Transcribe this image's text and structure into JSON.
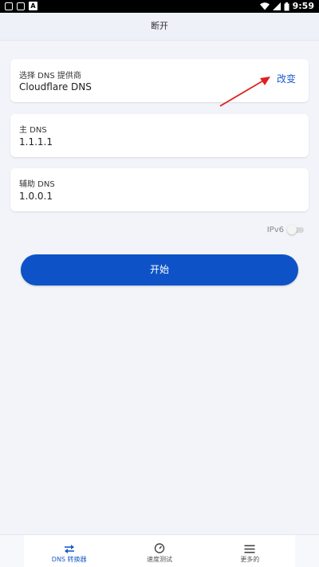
{
  "status_bar": {
    "time": "9:59",
    "app_icon_letter": "A"
  },
  "header": {
    "title": "断开"
  },
  "provider_card": {
    "label": "选择 DNS 提供商",
    "value": "Cloudflare DNS",
    "change_label": "改变"
  },
  "primary_dns": {
    "label": "主 DNS",
    "value": "1.1.1.1"
  },
  "secondary_dns": {
    "label": "辅助 DNS",
    "value": "1.0.0.1"
  },
  "ipv6": {
    "label": "IPv6",
    "enabled": false
  },
  "start_button": {
    "label": "开始"
  },
  "bottom_nav": {
    "items": [
      {
        "label": "DNS 转换器",
        "icon": "swap-arrows-icon",
        "active": true
      },
      {
        "label": "速度测试",
        "icon": "speedometer-icon",
        "active": false
      },
      {
        "label": "更多的",
        "icon": "menu-icon",
        "active": false
      }
    ]
  },
  "colors": {
    "accent": "#0d53c7",
    "link": "#1a5bc9",
    "annotation_arrow": "#e02020",
    "background": "#f2f4f9"
  }
}
